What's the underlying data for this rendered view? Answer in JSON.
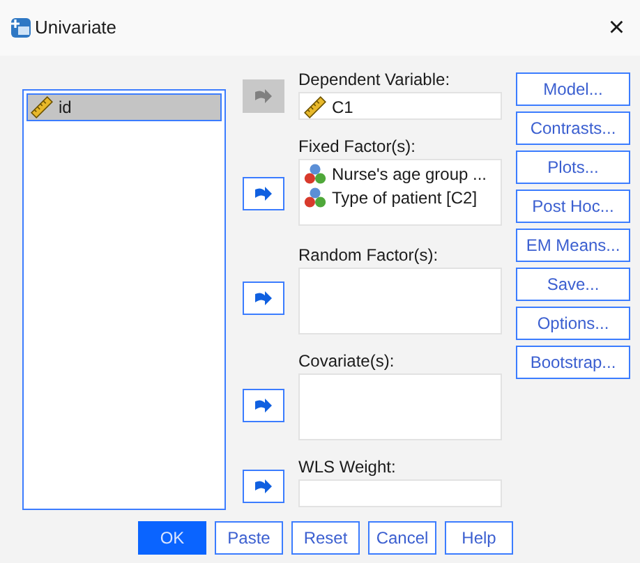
{
  "window": {
    "title": "Univariate",
    "close": "×"
  },
  "variables": [
    {
      "name": "id",
      "kind": "scale",
      "selected": true
    }
  ],
  "targets": [
    {
      "label": "Dependent Variable:",
      "kind": "field",
      "arrow_disabled": true,
      "items": [
        {
          "name": "C1",
          "kind": "scale"
        }
      ]
    },
    {
      "label": "Fixed Factor(s):",
      "kind": "list",
      "arrow_disabled": false,
      "items": [
        {
          "name": "Nurse's age group ...",
          "kind": "nominal"
        },
        {
          "name": "Type of patient [C2]",
          "kind": "nominal"
        }
      ]
    },
    {
      "label": "Random Factor(s):",
      "kind": "list",
      "arrow_disabled": false
    },
    {
      "label": "Covariate(s):",
      "kind": "list",
      "arrow_disabled": false
    },
    {
      "label": "WLS Weight:",
      "kind": "field",
      "arrow_disabled": false
    }
  ],
  "side_buttons": [
    {
      "label": "Model..."
    },
    {
      "label": "Contrasts..."
    },
    {
      "label": "Plots..."
    },
    {
      "label": "Post Hoc..."
    },
    {
      "label": "EM Means..."
    },
    {
      "label": "Save..."
    },
    {
      "label": "Options..."
    },
    {
      "label": "Bootstrap..."
    }
  ],
  "footer_buttons": [
    {
      "label": "OK",
      "primary": true
    },
    {
      "label": "Paste",
      "primary": false
    },
    {
      "label": "Reset",
      "primary": false
    },
    {
      "label": "Cancel",
      "primary": false
    },
    {
      "label": "Help",
      "primary": false
    }
  ]
}
